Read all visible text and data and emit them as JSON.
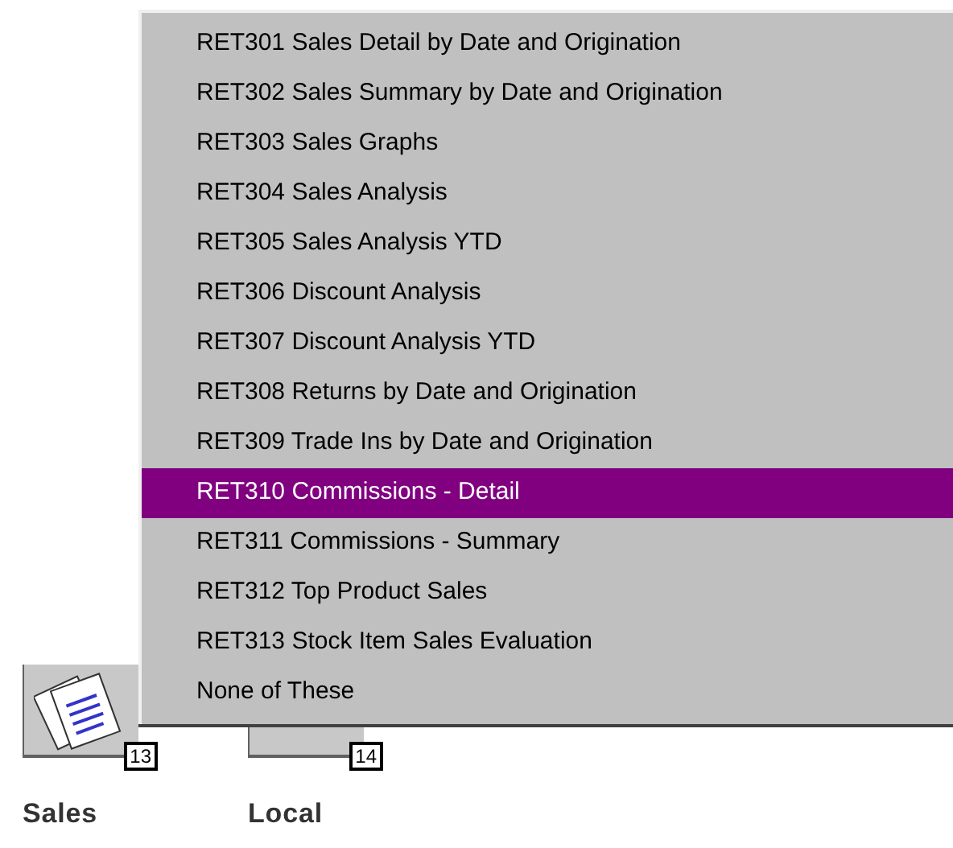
{
  "menu": {
    "items": [
      {
        "label": "RET301 Sales Detail by Date and Origination",
        "selected": false
      },
      {
        "label": "RET302 Sales Summary by Date and Origination",
        "selected": false
      },
      {
        "label": "RET303 Sales Graphs",
        "selected": false
      },
      {
        "label": "RET304 Sales Analysis",
        "selected": false
      },
      {
        "label": "RET305 Sales Analysis YTD",
        "selected": false
      },
      {
        "label": "RET306 Discount Analysis",
        "selected": false
      },
      {
        "label": "RET307 Discount Analysis YTD",
        "selected": false
      },
      {
        "label": "RET308 Returns by Date and Origination",
        "selected": false
      },
      {
        "label": "RET309 Trade Ins by Date and Origination",
        "selected": false
      },
      {
        "label": "RET310 Commissions - Detail",
        "selected": true
      },
      {
        "label": "RET311 Commissions - Summary",
        "selected": false
      },
      {
        "label": "RET312 Top Product Sales",
        "selected": false
      },
      {
        "label": "RET313 Stock Item Sales Evaluation",
        "selected": false
      },
      {
        "label": "None of These",
        "selected": false
      }
    ]
  },
  "shortcuts": [
    {
      "label": "Sales",
      "badge": "13"
    },
    {
      "label": "Local",
      "badge": "14"
    }
  ]
}
